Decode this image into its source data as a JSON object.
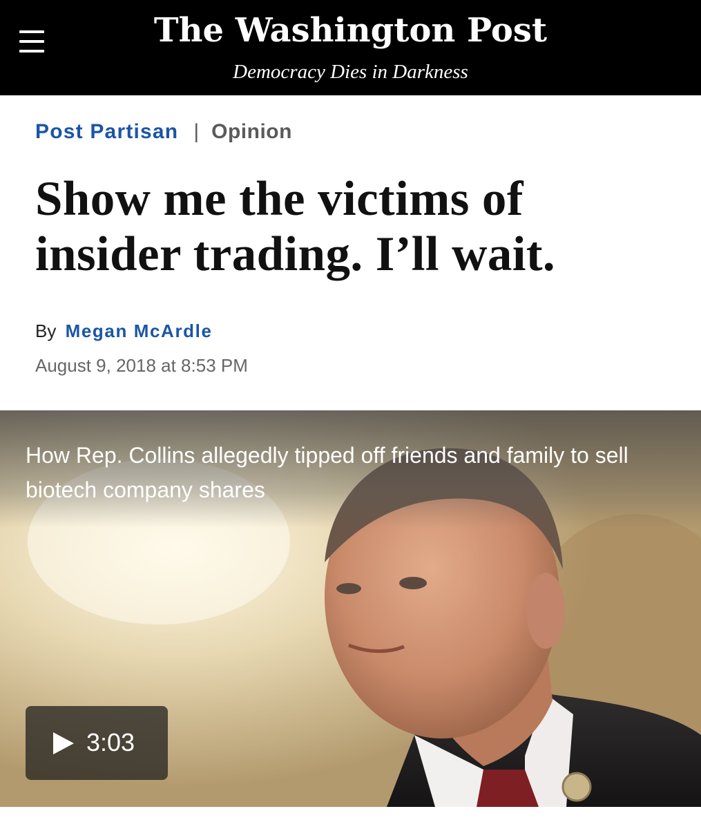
{
  "header": {
    "logo_text": "The Washington Post",
    "tagline": "Democracy Dies in Darkness"
  },
  "article": {
    "section": "Post Partisan",
    "separator": "|",
    "label": "Opinion",
    "headline": "Show me the victims of insider trading. I’ll wait.",
    "byline_prefix": "By",
    "author": "Megan McArdle",
    "timestamp": "August 9, 2018 at 8:53 PM"
  },
  "video": {
    "caption": "How Rep. Collins allegedly tipped off friends and family to sell biotech company shares",
    "duration": "3:03"
  }
}
